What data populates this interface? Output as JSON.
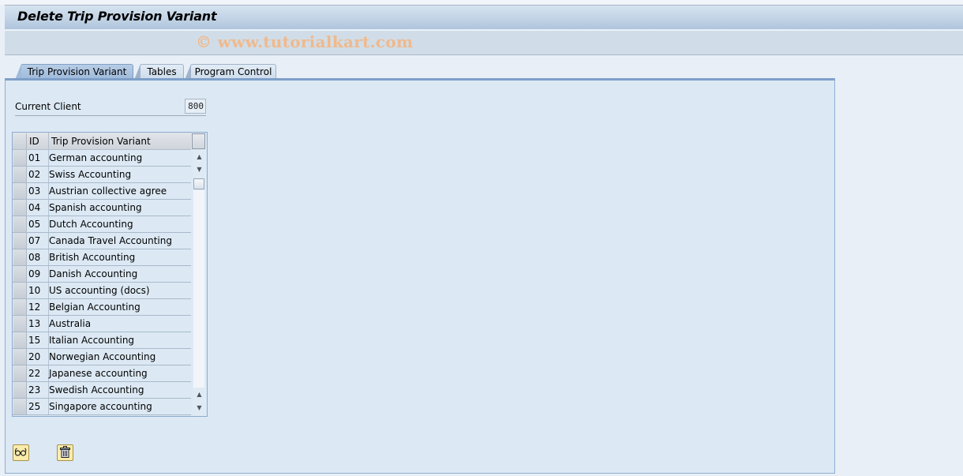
{
  "window": {
    "title": "Delete Trip Provision Variant"
  },
  "watermark": "© www.tutorialkart.com",
  "tabs": [
    {
      "label": "Trip Provision Variant",
      "active": true
    },
    {
      "label": "Tables",
      "active": false
    },
    {
      "label": "Program Control",
      "active": false
    }
  ],
  "client": {
    "label": "Current Client",
    "value": "800"
  },
  "table": {
    "columns": [
      "ID",
      "Trip Provision Variant"
    ],
    "rows": [
      {
        "id": "01",
        "name": "German accounting"
      },
      {
        "id": "02",
        "name": "Swiss Accounting"
      },
      {
        "id": "03",
        "name": "Austrian collective agree"
      },
      {
        "id": "04",
        "name": "Spanish accounting"
      },
      {
        "id": "05",
        "name": "Dutch Accounting"
      },
      {
        "id": "07",
        "name": "Canada Travel Accounting"
      },
      {
        "id": "08",
        "name": "British Accounting"
      },
      {
        "id": "09",
        "name": "Danish Accounting"
      },
      {
        "id": "10",
        "name": "US accounting (docs)"
      },
      {
        "id": "12",
        "name": "Belgian Accounting"
      },
      {
        "id": "13",
        "name": "Australia"
      },
      {
        "id": "15",
        "name": "Italian Accounting"
      },
      {
        "id": "20",
        "name": "Norwegian Accounting"
      },
      {
        "id": "22",
        "name": "Japanese accounting"
      },
      {
        "id": "23",
        "name": "Swedish Accounting"
      },
      {
        "id": "25",
        "name": "Singapore accounting"
      }
    ]
  },
  "actions": {
    "display_icon": "glasses-icon",
    "delete_icon": "trash-icon"
  }
}
